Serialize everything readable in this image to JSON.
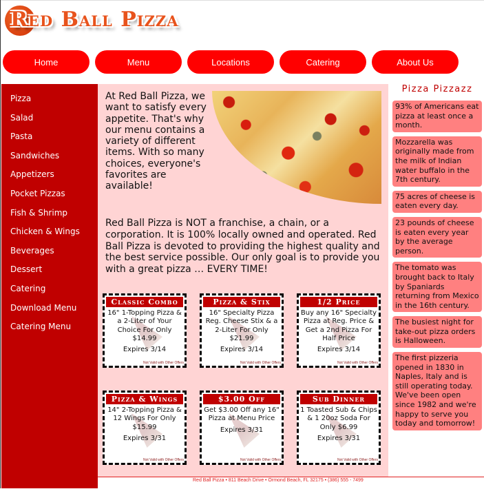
{
  "logo": {
    "text": "Red Ball Pizza"
  },
  "nav": [
    "Home",
    "Menu",
    "Locations",
    "Catering",
    "About Us"
  ],
  "sidebar": [
    "Pizza",
    "Salad",
    "Pasta",
    "Sandwiches",
    "Appetizers",
    "Pocket Pizzas",
    "Fish & Shrimp",
    "Chicken & Wings",
    "Beverages",
    "Dessert",
    "Catering",
    "Download Menu",
    "Catering Menu"
  ],
  "main": {
    "intro1": "At Red Ball Pizza, we want to satisfy every appetite. That's why our menu contains a variety of different items. With so many choices, everyone's favorites are available!",
    "intro2": "Red Ball Pizza is NOT a franchise, a chain, or a corporation. It is 100% locally owned and operated. Red Ball Pizza is devoted to providing the highest quality and the best service possible. Our only goal is to provide you with a great pizza … EVERY TIME!"
  },
  "coupons": [
    {
      "title": "Classic Combo",
      "body": "16\" 1-Topping Pizza & a 2-Liter of Your Choice For Only $14.99",
      "expires": "Expires 3/14",
      "fine": "Not Valid with Other Offers"
    },
    {
      "title": "Pizza & Stix",
      "body": "16\" Specialty Pizza Reg. Cheese Stix & a 2-Liter For Only $21.99",
      "expires": "Expires 3/14",
      "fine": "Not Valid with Other Offers"
    },
    {
      "title": "1/2 Price",
      "body": "Buy any 16\" Specialty Pizza at Reg. Price & Get a 2nd Pizza For Half Price",
      "expires": "Expires 3/14",
      "fine": "Not Valid with Other Offers"
    },
    {
      "title": "Pizza & Wings",
      "body": "14\" 2-Topping Pizza & 12 Wings For Only $15.99",
      "expires": "Expires 3/31",
      "fine": "Not Valid with Other Offers"
    },
    {
      "title": "$3.00 Off",
      "body": "Get $3.00 Off any 16\" Pizza at Menu Price",
      "expires": "Expires 3/31",
      "fine": "Not Valid with Other Offers"
    },
    {
      "title": "Sub Dinner",
      "body": "1 Toasted Sub & Chips & 1 20oz Soda For Only $6.99",
      "expires": "Expires 3/31",
      "fine": "Not Valid with Other Offers"
    }
  ],
  "right": {
    "title": "Pizza Pizzazz",
    "facts": [
      "93% of Americans eat pizza at least once a month.",
      "Mozzarella was originally made from the milk of Indian water buffalo in the 7th century.",
      "75 acres of cheese is eaten every day.",
      "23 pounds of cheese is eaten every year by the average person.",
      "The tomato was brought back to Italy by Spaniards returning from Mexico in the 16th century.",
      "The busiest night for take-out pizza orders is Halloween.",
      "The first pizzeria opened in 1830 in Naples, Italy and is still operating today. We've been open since 1982 and we're happy to serve you today and tomorrow!"
    ]
  },
  "footer": {
    "text": "Red Ball Pizza • 811 Beach Drive • Ormond Beach, FL 32175 • (386) 555 - 7499"
  },
  "colors": {
    "nav": "#ff0000",
    "sidebar": "#c00000",
    "main_bg": "#ffd4d4",
    "fact_bg": "#ff8080"
  }
}
